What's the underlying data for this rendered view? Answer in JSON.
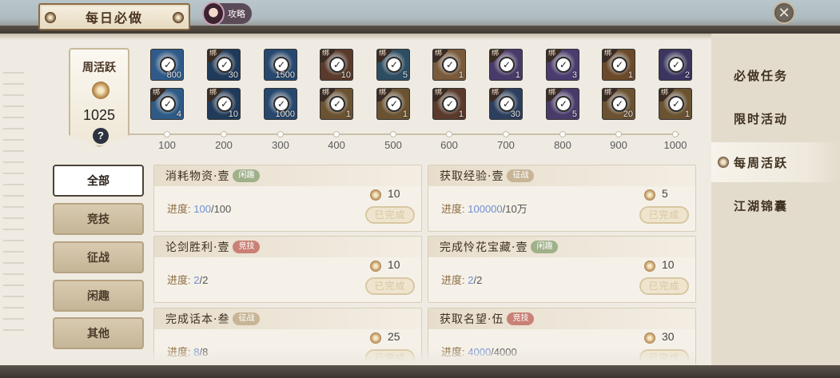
{
  "header": {
    "title": "每日必做",
    "guide_label": "攻略",
    "close_symbol": "✕"
  },
  "weekly": {
    "title": "周活跃",
    "value": "1025",
    "help": "?"
  },
  "rewards": {
    "bind_label": "绑",
    "row1": [
      {
        "qty": "800",
        "bound": false,
        "color": "#2f5b8a"
      },
      {
        "qty": "30",
        "bound": true,
        "color": "#203a5a"
      },
      {
        "qty": "1500",
        "bound": false,
        "color": "#27486f"
      },
      {
        "qty": "10",
        "bound": true,
        "color": "#5a3a2a"
      },
      {
        "qty": "5",
        "bound": true,
        "color": "#2d4d63"
      },
      {
        "qty": "1",
        "bound": true,
        "color": "#7a5a3a"
      },
      {
        "qty": "1",
        "bound": true,
        "color": "#4a3a6a"
      },
      {
        "qty": "3",
        "bound": true,
        "color": "#4b3b6f"
      },
      {
        "qty": "1",
        "bound": true,
        "color": "#6b4a2a"
      },
      {
        "qty": "2",
        "bound": false,
        "color": "#3b3560"
      }
    ],
    "row2": [
      {
        "qty": "4",
        "bound": true,
        "color": "#2e5a86"
      },
      {
        "qty": "10",
        "bound": true,
        "color": "#203a5a"
      },
      {
        "qty": "1000",
        "bound": false,
        "color": "#27486f"
      },
      {
        "qty": "1",
        "bound": true,
        "color": "#6b5230"
      },
      {
        "qty": "1",
        "bound": true,
        "color": "#6b5230"
      },
      {
        "qty": "1",
        "bound": true,
        "color": "#5a3a2a"
      },
      {
        "qty": "30",
        "bound": true,
        "color": "#2d3f5e"
      },
      {
        "qty": "5",
        "bound": true,
        "color": "#4a3a6a"
      },
      {
        "qty": "20",
        "bound": true,
        "color": "#6b5230"
      },
      {
        "qty": "1",
        "bound": true,
        "color": "#6b5230"
      }
    ],
    "milestones": [
      "100",
      "200",
      "300",
      "400",
      "500",
      "600",
      "700",
      "800",
      "900",
      "1000"
    ]
  },
  "categories": [
    {
      "label": "全部",
      "active": true
    },
    {
      "label": "竞技",
      "active": false
    },
    {
      "label": "征战",
      "active": false
    },
    {
      "label": "闲趣",
      "active": false
    },
    {
      "label": "其他",
      "active": false
    }
  ],
  "progress_label": "进度:",
  "done_label": "已完成",
  "tasks": [
    {
      "title": "消耗物资·壹",
      "tag": "闲趣",
      "tag_color": "green",
      "points": "10",
      "current": "100",
      "total": "/100"
    },
    {
      "title": "获取经验·壹",
      "tag": "征战",
      "tag_color": "tan",
      "points": "5",
      "current": "100000",
      "total": "/10万"
    },
    {
      "title": "论剑胜利·壹",
      "tag": "竞技",
      "tag_color": "red",
      "points": "10",
      "current": "2",
      "total": "/2"
    },
    {
      "title": "完成怜花宝藏·壹",
      "tag": "闲趣",
      "tag_color": "green",
      "points": "10",
      "current": "2",
      "total": "/2"
    },
    {
      "title": "完成话本·叁",
      "tag": "征战",
      "tag_color": "tan",
      "points": "25",
      "current": "8",
      "total": "/8"
    },
    {
      "title": "获取名望·伍",
      "tag": "竞技",
      "tag_color": "red",
      "points": "30",
      "current": "4000",
      "total": "/4000"
    }
  ],
  "sidebar": {
    "items": [
      {
        "label": "必做任务",
        "active": false
      },
      {
        "label": "限时活动",
        "active": false
      },
      {
        "label": "每周活跃",
        "active": true
      },
      {
        "label": "江湖锦囊",
        "active": false
      }
    ]
  }
}
